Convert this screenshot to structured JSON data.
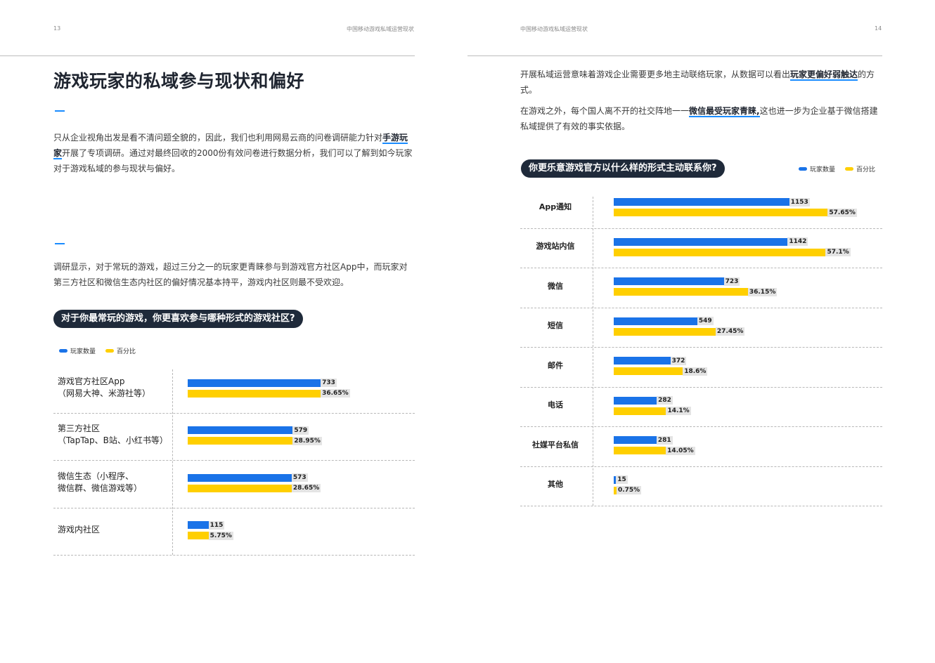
{
  "left_page": {
    "page_number": "13",
    "running_header": "中国移动游戏私域运营现状",
    "title": "游戏玩家的私域参与现状和偏好",
    "para1_a": "只从企业视角出发是看不清问题全貌的，因此，我们也利用网易云商的问卷调研能力针对",
    "para1_hl1": "手游玩",
    "para1_hl2": "家",
    "para1_b": "开展了专项调研。通过对最终回收的2000份有效问卷进行数据分析，我们可以了解到如今玩家对于游戏私域的参与现状与偏好。",
    "para2": "调研显示，对于常玩的游戏，超过三分之一的玩家更青睐参与到游戏官方社区App中，而玩家对第三方社区和微信生态内社区的偏好情况基本持平，游戏内社区则最不受欢迎。",
    "chart_title": "对于你最常玩的游戏，你更喜欢参与哪种形式的游戏社区?",
    "legend": {
      "count": "玩家数量",
      "percent": "百分比"
    }
  },
  "right_page": {
    "page_number": "14",
    "running_header": "中国移动游戏私域运营现状",
    "para1_a": "开展私域运营意味着游戏企业需要更多地主动联络玩家，从数据可以看出",
    "para1_hl": "玩家更偏好弱触达",
    "para1_b": "的方式。",
    "para2_a": "在游戏之外，每个国人离不开的社交阵地一一",
    "para2_hl": "微信最受玩家青睐,",
    "para2_b": "这也进一步为企业基于微信搭建私域提供了有效的事实依据。",
    "chart_title": "你更乐意游戏官方以什么样的形式主动联系你?",
    "legend": {
      "count": "玩家数量",
      "percent": "百分比"
    }
  },
  "colors": {
    "count": "#1a73e8",
    "percent": "#ffcf00",
    "pill": "#1f2a3a",
    "accent": "#1a8cff"
  },
  "chart_data": [
    {
      "type": "bar",
      "orientation": "horizontal",
      "title": "对于你最常玩的游戏，你更喜欢参与哪种形式的游戏社区?",
      "categories": [
        [
          "游戏官方社区App",
          "（网易大神、米游社等）"
        ],
        [
          "第三方社区",
          "（TapTap、B站、小红书等）"
        ],
        [
          "微信生态（小程序、",
          "微信群、微信游戏等）"
        ],
        [
          "游戏内社区"
        ]
      ],
      "series": [
        {
          "name": "玩家数量",
          "values": [
            733,
            579,
            573,
            115
          ],
          "labels": [
            "733",
            "579",
            "573",
            "115"
          ]
        },
        {
          "name": "百分比",
          "values": [
            36.65,
            28.95,
            28.65,
            5.75
          ],
          "labels": [
            "36.65%",
            "28.95%",
            "28.65%",
            "5.75%"
          ]
        }
      ],
      "legend": "top-left"
    },
    {
      "type": "bar",
      "orientation": "horizontal",
      "title": "你更乐意游戏官方以什么样的形式主动联系你?",
      "categories": [
        [
          "App通知"
        ],
        [
          "游戏站内信"
        ],
        [
          "微信"
        ],
        [
          "短信"
        ],
        [
          "邮件"
        ],
        [
          "电话"
        ],
        [
          "社媒平台私信"
        ],
        [
          "其他"
        ]
      ],
      "series": [
        {
          "name": "玩家数量",
          "values": [
            1153,
            1142,
            723,
            549,
            372,
            282,
            281,
            15
          ],
          "labels": [
            "1153",
            "1142",
            "723",
            "549",
            "372",
            "282",
            "281",
            "15"
          ]
        },
        {
          "name": "百分比",
          "values": [
            57.65,
            57.1,
            36.15,
            27.45,
            18.6,
            14.1,
            14.05,
            0.75
          ],
          "labels": [
            "57.65%",
            "57.1%",
            "36.15%",
            "27.45%",
            "18.6%",
            "14.1%",
            "14.05%",
            "0.75%"
          ]
        }
      ],
      "legend": "top-right"
    }
  ]
}
